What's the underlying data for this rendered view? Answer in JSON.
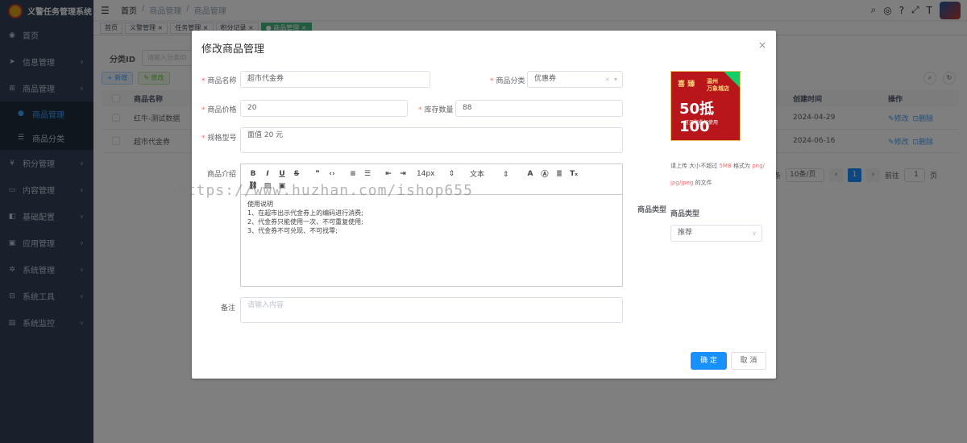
{
  "app": {
    "title": "义警任务管理系统"
  },
  "sidebar": {
    "items": [
      {
        "label": "首页",
        "icon": "dashboard-icon"
      },
      {
        "label": "信息管理",
        "icon": "send-icon"
      },
      {
        "label": "商品管理",
        "icon": "cart-icon"
      },
      {
        "label": "积分管理",
        "icon": "yen-icon"
      },
      {
        "label": "内容管理",
        "icon": "content-icon"
      },
      {
        "label": "基础配置",
        "icon": "config-icon"
      },
      {
        "label": "应用管理",
        "icon": "app-icon"
      },
      {
        "label": "系统管理",
        "icon": "gear-icon"
      },
      {
        "label": "系统工具",
        "icon": "tool-icon"
      },
      {
        "label": "系统监控",
        "icon": "monitor-icon"
      }
    ],
    "sub_items": [
      {
        "label": "商品管理"
      },
      {
        "label": "商品分类"
      }
    ]
  },
  "header": {
    "breadcrumb": [
      "首页",
      "商品管理",
      "商品管理"
    ],
    "separator": "/"
  },
  "tags": [
    "首页",
    "义警管理 ×",
    "任务管理 ×",
    "积分记录 ×",
    "● 商品管理 ×"
  ],
  "page": {
    "search_label": "分类ID",
    "search_placeholder": "请输入分类ID",
    "btn_add": "+ 新增",
    "btn_edit": "✎ 修改",
    "columns": {
      "name": "商品名称",
      "created": "创建时间",
      "op": "操作"
    },
    "rows": [
      {
        "name": "红牛-测试数据",
        "created": "2024-04-29",
        "edit": "✎修改",
        "del": "⊡删除"
      },
      {
        "name": "超市代金券",
        "created": "2024-06-16",
        "edit": "✎修改",
        "del": "⊡删除"
      }
    ],
    "pager": {
      "size": "10条/页",
      "page": "1",
      "goto_prefix": "前往",
      "goto_value": "1",
      "goto_suffix": "页",
      "tail": "条"
    }
  },
  "dialog": {
    "title": "修改商品管理",
    "close": "×",
    "fields": {
      "name": {
        "label": "商品名称",
        "value": "超市代金券"
      },
      "category": {
        "label": "商品分类",
        "value": "优惠券"
      },
      "price": {
        "label": "商品价格",
        "value": "20"
      },
      "stock": {
        "label": "库存数量",
        "value": "88"
      },
      "spec": {
        "label": "规格型号",
        "value": "面值 20 元"
      },
      "intro": {
        "label": "商品介绍"
      },
      "type": {
        "label": "商品类型",
        "sublabel": "商品类型",
        "value": "推荐"
      },
      "remark": {
        "label": "备注",
        "placeholder": "请输入内容"
      }
    },
    "editor": {
      "font_size": "14px",
      "block": "文本",
      "lines": [
        "使用说明",
        "1、在超市出示代金券上的编码进行消费;",
        "2、代金券只能使用一次、不可重复使用;",
        "3、代金券不可兑现、不可找零;"
      ]
    },
    "image": {
      "t1": "喜 臻",
      "t2": "温州\n万象城店",
      "t3": "50抵100",
      "t4": "可无限叠加使用"
    },
    "upload_tip": {
      "pre": "请上传 大小不超过",
      "size": "5MB",
      "mid": "格式为",
      "fmt": "png/ jpg/jpeg",
      "post": "的文件"
    },
    "btn_ok": "确 定",
    "btn_cancel": "取 消"
  },
  "watermark": "https://www.huzhan.com/ishop655"
}
